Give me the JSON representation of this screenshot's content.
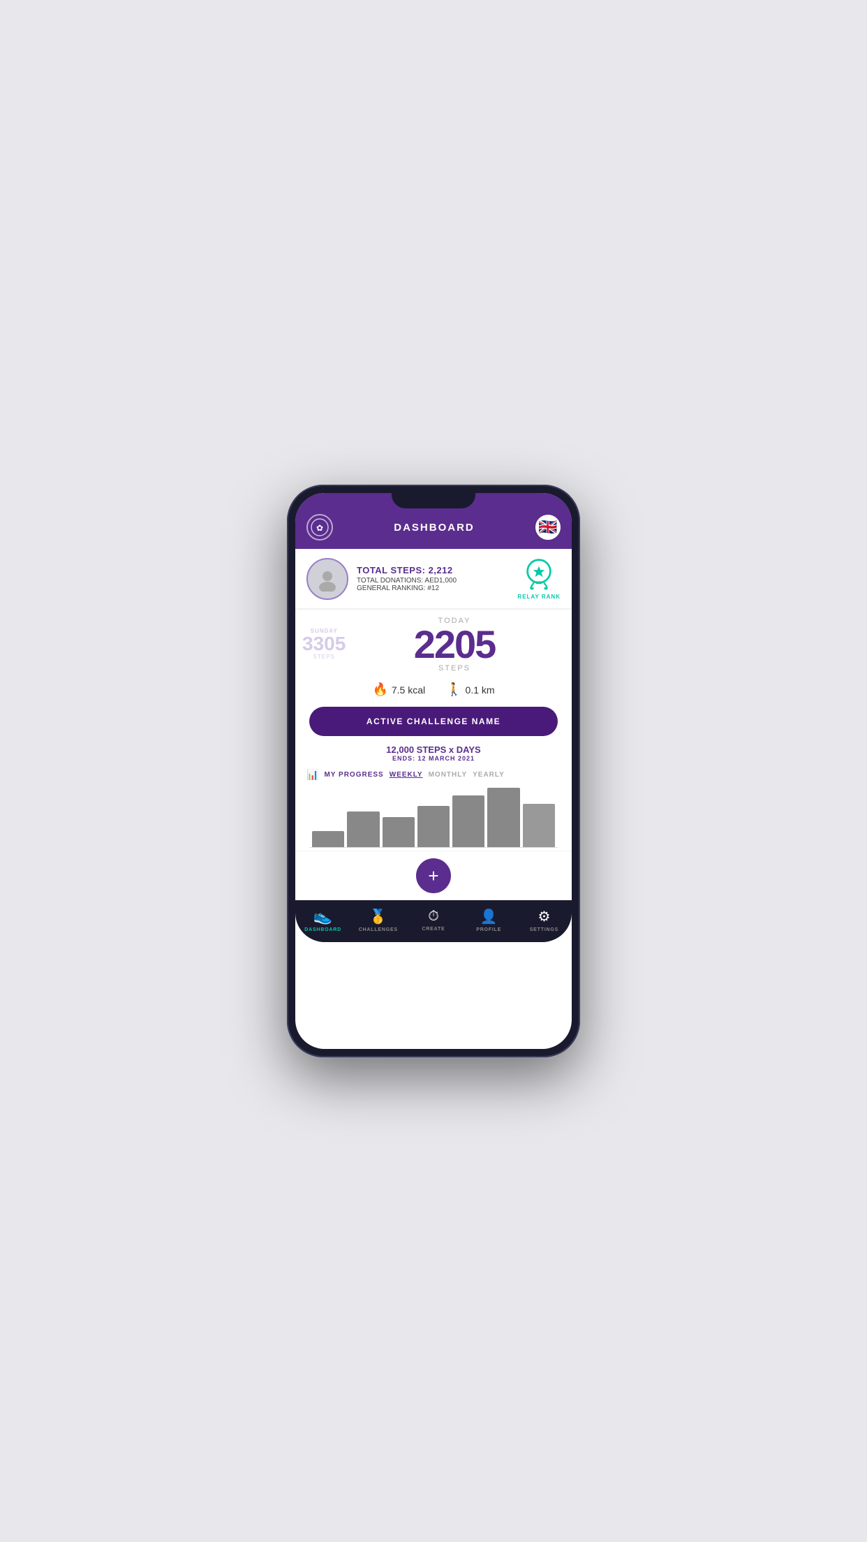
{
  "header": {
    "title": "DASHBOARD",
    "logo_icon": "⬡",
    "flag_emoji": "🇬🇧"
  },
  "profile": {
    "total_steps_label": "TOTAL STEPS: 2,212",
    "donation_label": "TOTAL DONATIONS: AED1,000",
    "ranking_label": "GENERAL RANKING: #12",
    "relay_label": "RELAY RANK"
  },
  "today": {
    "label": "TODAY",
    "steps": "2205",
    "steps_label": "STEPS"
  },
  "yesterday": {
    "day": "SUNDAY",
    "steps": "3305",
    "steps_label": "STEPS"
  },
  "metrics": {
    "kcal_icon": "🔥",
    "kcal_value": "7.5 kcal",
    "km_icon": "🚶",
    "km_value": "0.1 km"
  },
  "challenge": {
    "button_label": "ACTIVE CHALLENGE NAME",
    "steps_text": "12,000 STEPS x DAYS",
    "ends_label": "ENDS: 12 MARCH 2021"
  },
  "progress": {
    "icon": "📊",
    "label": "MY PROGRESS",
    "tabs": [
      "WEEKLY",
      "MONTHLY",
      "YEARLY"
    ],
    "active_tab": "WEEKLY",
    "bars": [
      20,
      45,
      38,
      52,
      65,
      75,
      55
    ]
  },
  "nav": {
    "items": [
      {
        "id": "dashboard",
        "icon": "👟",
        "label": "DASHBOARD",
        "active": true
      },
      {
        "id": "challenges",
        "icon": "🥇",
        "label": "CHALLENGES",
        "active": false
      },
      {
        "id": "create",
        "icon": "⏱",
        "label": "CREATE",
        "active": false
      },
      {
        "id": "profile",
        "icon": "👤",
        "label": "PROFILE",
        "active": false
      },
      {
        "id": "settings",
        "icon": "⚙",
        "label": "SETTINGS",
        "active": false
      }
    ]
  }
}
